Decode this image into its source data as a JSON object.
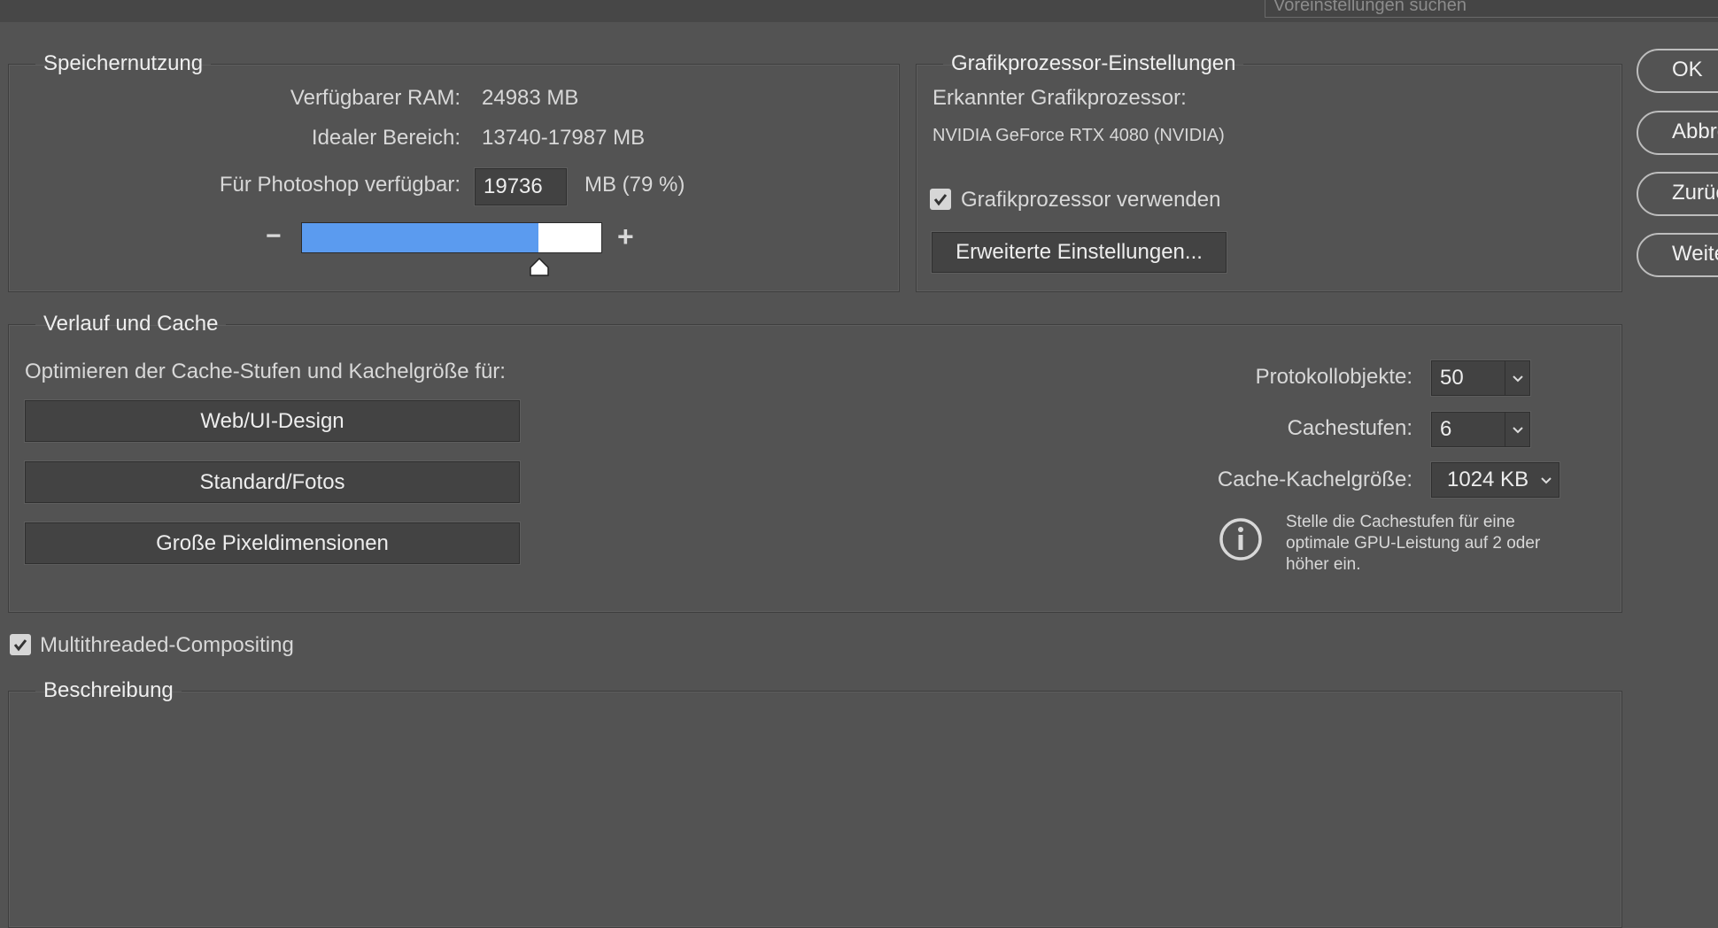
{
  "search": {
    "placeholder": "Voreinstellungen suchen"
  },
  "memory": {
    "title": "Speichernutzung",
    "ram_label": "Verfügbarer RAM:",
    "ram_value": "24983 MB",
    "ideal_label": "Idealer Bereich:",
    "ideal_value": "13740-17987 MB",
    "ps_label": "Für Photoshop verfügbar:",
    "ps_value": "19736",
    "ps_unit": "MB (79 %)",
    "slider_fraction": 0.79,
    "minus": "−",
    "plus": "+"
  },
  "gpu": {
    "title": "Grafikprozessor-Einstellungen",
    "detected_label": "Erkannter Grafikprozessor:",
    "detected_value": "NVIDIA GeForce RTX 4080 (NVIDIA)",
    "use_label": "Grafikprozessor verwenden",
    "use_checked": true,
    "advanced_button": "Erweiterte Einstellungen..."
  },
  "side_buttons": [
    "OK",
    "Abbrechen",
    "Zurück",
    "Weiter"
  ],
  "history": {
    "title": "Verlauf und Cache",
    "optimize_label": "Optimieren der Cache-Stufen und Kachelgröße für:",
    "buttons": [
      "Web/UI-Design",
      "Standard/Fotos",
      "Große Pixeldimensionen"
    ],
    "history_states_label": "Protokollobjekte:",
    "history_states_value": "50",
    "cache_levels_label": "Cachestufen:",
    "cache_levels_value": "6",
    "tile_size_label": "Cache-Kachelgröße:",
    "tile_size_value": "1024 KB",
    "info_text": [
      "Stelle die Cachestufen für eine",
      "optimale GPU-Leistung auf 2 oder",
      "höher ein."
    ]
  },
  "multithread": {
    "label": "Multithreaded-Compositing",
    "checked": true
  },
  "description": {
    "title": "Beschreibung"
  }
}
